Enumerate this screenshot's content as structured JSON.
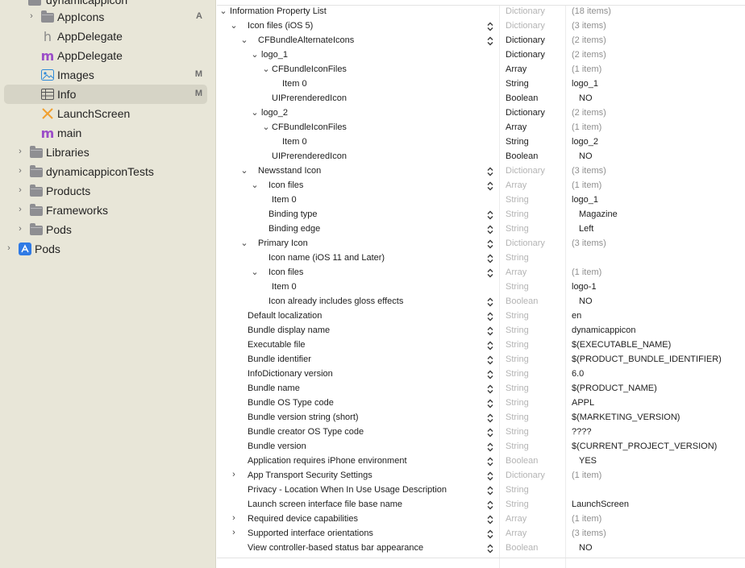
{
  "sidebar": {
    "items": [
      {
        "label": "dynamicappicon",
        "icon": "folder-icon",
        "disclosure": "",
        "badge": ""
      },
      {
        "label": "AppIcons",
        "icon": "folder-icon",
        "disclosure": "›",
        "badge": "A"
      },
      {
        "label": "AppDelegate",
        "icon": "header-file-icon",
        "disclosure": "",
        "badge": ""
      },
      {
        "label": "AppDelegate",
        "icon": "objc-file-icon",
        "disclosure": "",
        "badge": ""
      },
      {
        "label": "Images",
        "icon": "asset-catalog-icon",
        "disclosure": "",
        "badge": "M"
      },
      {
        "label": "Info",
        "icon": "plist-table-icon",
        "disclosure": "",
        "badge": "M",
        "selected": true
      },
      {
        "label": "LaunchScreen",
        "icon": "storyboard-icon",
        "disclosure": "",
        "badge": ""
      },
      {
        "label": "main",
        "icon": "objc-file-icon",
        "disclosure": "",
        "badge": ""
      },
      {
        "label": "Libraries",
        "icon": "folder-icon",
        "disclosure": "›",
        "badge": ""
      },
      {
        "label": "dynamicappiconTests",
        "icon": "folder-icon",
        "disclosure": "›",
        "badge": ""
      },
      {
        "label": "Products",
        "icon": "folder-icon",
        "disclosure": "›",
        "badge": ""
      },
      {
        "label": "Frameworks",
        "icon": "folder-icon",
        "disclosure": "›",
        "badge": ""
      },
      {
        "label": "Pods",
        "icon": "folder-icon",
        "disclosure": "›",
        "badge": ""
      },
      {
        "label": "Pods",
        "icon": "project-icon",
        "disclosure": "›",
        "badge": ""
      }
    ]
  },
  "plist": {
    "rows": [
      {
        "key": "Information Property List",
        "type": "Dictionary",
        "value": "(18 items)",
        "disc": "⌄",
        "typeDim": true,
        "valDim": true
      },
      {
        "key": "Icon files (iOS 5)",
        "type": "Dictionary",
        "value": "(3 items)",
        "disc": "⌄",
        "typeDim": true,
        "valDim": true,
        "stepper": true
      },
      {
        "key": "CFBundleAlternateIcons",
        "type": "Dictionary",
        "value": "(2 items)",
        "disc": "⌄",
        "typeDim": false,
        "valDim": true,
        "stepper": true
      },
      {
        "key": "logo_1",
        "type": "Dictionary",
        "value": "(2 items)",
        "disc": "⌄",
        "typeDim": false,
        "valDim": true
      },
      {
        "key": "CFBundleIconFiles",
        "type": "Array",
        "value": "(1 item)",
        "disc": "⌄",
        "typeDim": false,
        "valDim": true
      },
      {
        "key": "Item 0",
        "type": "String",
        "value": "logo_1",
        "disc": "",
        "typeDim": false,
        "valDim": false
      },
      {
        "key": "UIPrerenderedIcon",
        "type": "Boolean",
        "value": "NO",
        "disc": "",
        "typeDim": false,
        "valDim": false,
        "bool": true
      },
      {
        "key": "logo_2",
        "type": "Dictionary",
        "value": "(2 items)",
        "disc": "⌄",
        "typeDim": false,
        "valDim": true
      },
      {
        "key": "CFBundleIconFiles",
        "type": "Array",
        "value": "(1 item)",
        "disc": "⌄",
        "typeDim": false,
        "valDim": true
      },
      {
        "key": "Item 0",
        "type": "String",
        "value": "logo_2",
        "disc": "",
        "typeDim": false,
        "valDim": false
      },
      {
        "key": "UIPrerenderedIcon",
        "type": "Boolean",
        "value": "NO",
        "disc": "",
        "typeDim": false,
        "valDim": false,
        "bool": true
      },
      {
        "key": "Newsstand Icon",
        "type": "Dictionary",
        "value": "(3 items)",
        "disc": "⌄",
        "typeDim": true,
        "valDim": true,
        "stepper": true
      },
      {
        "key": "Icon files",
        "type": "Array",
        "value": "(1 item)",
        "disc": "⌄",
        "typeDim": true,
        "valDim": true,
        "stepper": true
      },
      {
        "key": "Item 0",
        "type": "String",
        "value": "logo_1",
        "disc": "",
        "typeDim": true,
        "valDim": false
      },
      {
        "key": "Binding type",
        "type": "String",
        "value": "Magazine",
        "disc": "",
        "typeDim": true,
        "valDim": false,
        "stepper": true,
        "bool": true
      },
      {
        "key": "Binding edge",
        "type": "String",
        "value": "Left",
        "disc": "",
        "typeDim": true,
        "valDim": false,
        "stepper": true,
        "bool": true
      },
      {
        "key": "Primary Icon",
        "type": "Dictionary",
        "value": "(3 items)",
        "disc": "⌄",
        "typeDim": true,
        "valDim": true,
        "stepper": true
      },
      {
        "key": "Icon name (iOS 11 and Later)",
        "type": "String",
        "value": "",
        "disc": "",
        "typeDim": true,
        "valDim": false,
        "stepper": true
      },
      {
        "key": "Icon files",
        "type": "Array",
        "value": "(1 item)",
        "disc": "⌄",
        "typeDim": true,
        "valDim": true,
        "stepper": true
      },
      {
        "key": "Item 0",
        "type": "String",
        "value": "logo-1",
        "disc": "",
        "typeDim": true,
        "valDim": false
      },
      {
        "key": "Icon already includes gloss effects",
        "type": "Boolean",
        "value": "NO",
        "disc": "",
        "typeDim": true,
        "valDim": false,
        "stepper": true,
        "bool": true
      },
      {
        "key": "Default localization",
        "type": "String",
        "value": "en",
        "disc": "",
        "typeDim": true,
        "valDim": false,
        "stepper": true
      },
      {
        "key": "Bundle display name",
        "type": "String",
        "value": "dynamicappicon",
        "disc": "",
        "typeDim": true,
        "valDim": false,
        "stepper": true
      },
      {
        "key": "Executable file",
        "type": "String",
        "value": "$(EXECUTABLE_NAME)",
        "disc": "",
        "typeDim": true,
        "valDim": false,
        "stepper": true
      },
      {
        "key": "Bundle identifier",
        "type": "String",
        "value": "$(PRODUCT_BUNDLE_IDENTIFIER)",
        "disc": "",
        "typeDim": true,
        "valDim": false,
        "stepper": true
      },
      {
        "key": "InfoDictionary version",
        "type": "String",
        "value": "6.0",
        "disc": "",
        "typeDim": true,
        "valDim": false,
        "stepper": true
      },
      {
        "key": "Bundle name",
        "type": "String",
        "value": "$(PRODUCT_NAME)",
        "disc": "",
        "typeDim": true,
        "valDim": false,
        "stepper": true
      },
      {
        "key": "Bundle OS Type code",
        "type": "String",
        "value": "APPL",
        "disc": "",
        "typeDim": true,
        "valDim": false,
        "stepper": true
      },
      {
        "key": "Bundle version string (short)",
        "type": "String",
        "value": "$(MARKETING_VERSION)",
        "disc": "",
        "typeDim": true,
        "valDim": false,
        "stepper": true
      },
      {
        "key": "Bundle creator OS Type code",
        "type": "String",
        "value": "????",
        "disc": "",
        "typeDim": true,
        "valDim": false,
        "stepper": true
      },
      {
        "key": "Bundle version",
        "type": "String",
        "value": "$(CURRENT_PROJECT_VERSION)",
        "disc": "",
        "typeDim": true,
        "valDim": false,
        "stepper": true
      },
      {
        "key": "Application requires iPhone environment",
        "type": "Boolean",
        "value": "YES",
        "disc": "",
        "typeDim": true,
        "valDim": false,
        "stepper": true,
        "bool": true
      },
      {
        "key": "App Transport Security Settings",
        "type": "Dictionary",
        "value": "(1 item)",
        "disc": "›",
        "typeDim": true,
        "valDim": true,
        "stepper": true
      },
      {
        "key": "Privacy - Location When In Use Usage Description",
        "type": "String",
        "value": "",
        "disc": "",
        "typeDim": true,
        "valDim": false,
        "stepper": true
      },
      {
        "key": "Launch screen interface file base name",
        "type": "String",
        "value": "LaunchScreen",
        "disc": "",
        "typeDim": true,
        "valDim": false,
        "stepper": true
      },
      {
        "key": "Required device capabilities",
        "type": "Array",
        "value": "(1 item)",
        "disc": "›",
        "typeDim": true,
        "valDim": true,
        "stepper": true
      },
      {
        "key": "Supported interface orientations",
        "type": "Array",
        "value": "(3 items)",
        "disc": "›",
        "typeDim": true,
        "valDim": true,
        "stepper": true
      },
      {
        "key": "View controller-based status bar appearance",
        "type": "Boolean",
        "value": "NO",
        "disc": "",
        "typeDim": true,
        "valDim": false,
        "stepper": true,
        "bool": true
      }
    ]
  },
  "colors": {
    "sidebar_bg": "#e8e6d8",
    "selection": "#d6d4c6",
    "folder": "#8e8e92",
    "objc_m": "#9b4dc8",
    "swift_orange": "#f0a030",
    "project_blue": "#2f7ae5"
  }
}
